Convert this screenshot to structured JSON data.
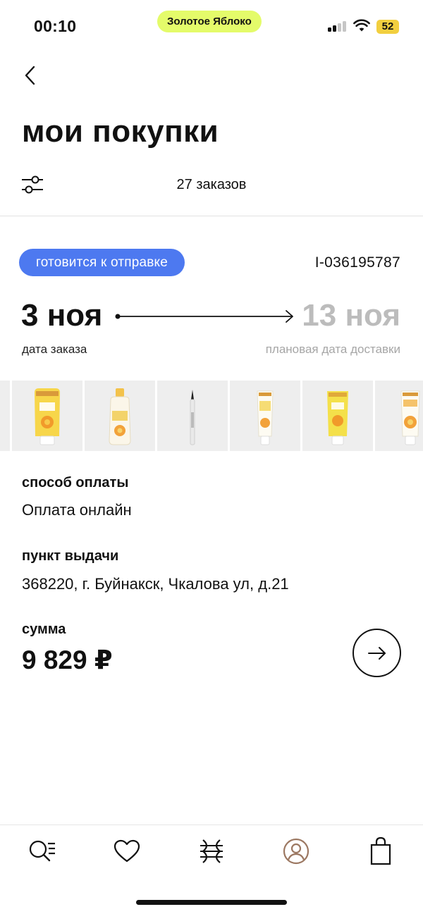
{
  "status_bar": {
    "time": "00:10",
    "app_name": "Золотое Яблоко",
    "battery": "52",
    "app_pill_color": "#e4fb6a",
    "battery_color": "#f2cf3f"
  },
  "header": {
    "back_icon": "chevron-left-icon",
    "title": "мои покупки",
    "filter_icon": "filter-sliders-icon",
    "orders_count": "27 заказов"
  },
  "order": {
    "status": "готовится к отправке",
    "status_color": "#4d79f0",
    "number": "I-036195787",
    "order_date": "3 ноя",
    "order_date_label": "дата заказа",
    "delivery_date": "13 ноя",
    "delivery_date_label": "плановая дата доставки",
    "products": [
      {
        "name": "weleda-baby-tube-product",
        "type": "tube",
        "color": "#f7d64a"
      },
      {
        "name": "weleda-baby-bottle-product",
        "type": "bottle",
        "color": "#f3c24a"
      },
      {
        "name": "eyeliner-pen-product",
        "type": "pen",
        "color": "#cfcfcf"
      },
      {
        "name": "weleda-cream-tube-product",
        "type": "slim-tube",
        "color": "#f6dc74"
      },
      {
        "name": "weleda-yellow-tube-product",
        "type": "tube",
        "color": "#f4e04a"
      },
      {
        "name": "weleda-calendula-tube-product",
        "type": "slim-tube",
        "color": "#f5c36a"
      }
    ],
    "payment_label": "способ оплаты",
    "payment_value": "Оплата онлайн",
    "pickup_label": "пункт выдачи",
    "pickup_value": "368220, г. Буйнакск, Чкалова ул, д.21",
    "sum_label": "сумма",
    "sum_value": "9 829 ₽",
    "open_icon": "arrow-right-icon"
  },
  "tabbar": {
    "tabs": [
      {
        "name": "catalog-search-icon"
      },
      {
        "name": "favorites-heart-icon"
      },
      {
        "name": "brand-logo-icon"
      },
      {
        "name": "profile-icon",
        "active": true,
        "active_color": "#9c7862"
      },
      {
        "name": "shopping-bag-icon"
      }
    ]
  }
}
